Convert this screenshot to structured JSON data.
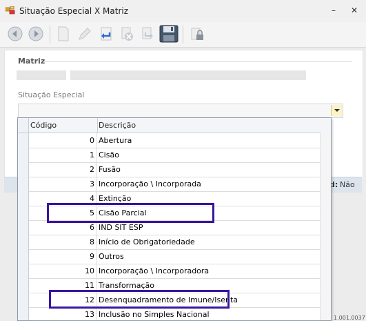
{
  "window": {
    "title": "Situação Especial X Matriz",
    "minimize": "–",
    "close": "✕"
  },
  "toolbar": {
    "icons": [
      "back-arrow-icon",
      "forward-arrow-icon",
      "new-document-icon",
      "edit-icon",
      "undo-icon",
      "delete-icon",
      "redo-icon",
      "save-icon",
      "lock-icon"
    ]
  },
  "form": {
    "section_title": "Matriz",
    "situacao_label": "Situação Especial",
    "ativo_label": "d:",
    "ativo_value": "Não"
  },
  "footer": {
    "code": "1.001.0037"
  },
  "grid": {
    "columns": [
      "Código",
      "Descrição"
    ],
    "rows": [
      {
        "code": "0",
        "desc": "Abertura"
      },
      {
        "code": "1",
        "desc": "Cisão"
      },
      {
        "code": "2",
        "desc": "Fusão"
      },
      {
        "code": "3",
        "desc": "Incorporação \\ Incorporada"
      },
      {
        "code": "4",
        "desc": "Extinção"
      },
      {
        "code": "5",
        "desc": "Cisão Parcial"
      },
      {
        "code": "6",
        "desc": "IND SIT ESP"
      },
      {
        "code": "8",
        "desc": "Início de Obrigatoriedade"
      },
      {
        "code": "9",
        "desc": "Outros"
      },
      {
        "code": "10",
        "desc": "Incorporação \\ Incorporadora"
      },
      {
        "code": "11",
        "desc": "Transformação"
      },
      {
        "code": "12",
        "desc": "Desenquadramento de Imune/Isenta"
      },
      {
        "code": "13",
        "desc": "Inclusão no Simples Nacional"
      }
    ]
  },
  "colors": {
    "highlight": "#3a15a0",
    "combo_button": "#fdf3c6"
  }
}
